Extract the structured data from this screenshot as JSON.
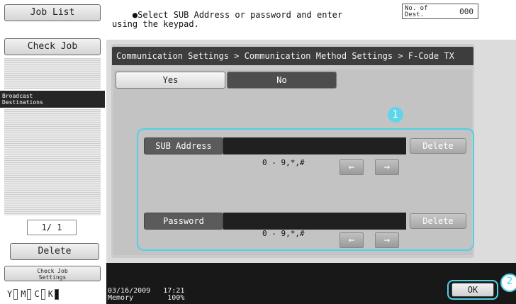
{
  "left_panel": {
    "job_list": "Job List",
    "check_job": "Check Job",
    "broadcast_tab": "Broadcast\nDestinations",
    "page_indicator": "1/  1",
    "delete": "Delete",
    "check_job_settings": "Check Job\nSettings",
    "toner": [
      {
        "label": "Y",
        "level": "low"
      },
      {
        "label": "M",
        "level": "low"
      },
      {
        "label": "C",
        "level": "low"
      },
      {
        "label": "K",
        "level": "full"
      }
    ]
  },
  "header": {
    "instruction": "Select SUB Address or password and enter\nusing the keypad.",
    "dest_label": "No. of\nDest.",
    "dest_count": "000"
  },
  "breadcrumb": "Communication Settings > Communication Method Settings > F-Code TX",
  "toggle": {
    "yes": "Yes",
    "no": "No",
    "selected": "No"
  },
  "fields": {
    "sub_address": {
      "label": "SUB Address",
      "value": "",
      "hint": "0 - 9,*,#",
      "delete": "Delete"
    },
    "password": {
      "label": "Password",
      "value": "",
      "hint": "0 - 9,*,#",
      "delete": "Delete"
    }
  },
  "arrows": {
    "left": "←",
    "right": "→"
  },
  "callouts": {
    "one": "1",
    "two": "2"
  },
  "footer": {
    "datetime": "03/16/2009   17:21\nMemory        100%",
    "ok": "OK"
  },
  "colors": {
    "accent": "#4fd0e6",
    "selected": "#4d4d4d"
  }
}
